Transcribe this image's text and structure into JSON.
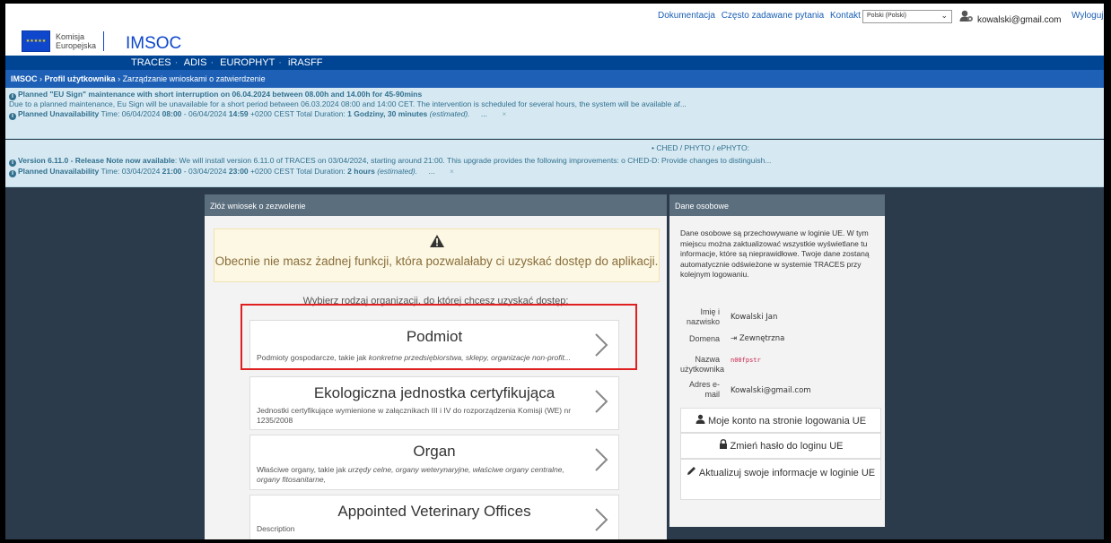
{
  "header": {
    "logo_line1": "Komisja",
    "logo_line2": "Europejska",
    "app_name": "IMSOC",
    "links": [
      "Dokumentacja",
      "Często zadawane pytania",
      "Kontakt"
    ],
    "language": "Polski (Polski)",
    "user_email": "kowalski@gmail.com",
    "logout": "Wyloguj"
  },
  "nav": {
    "items": [
      "TRACES",
      "ADIS",
      "EUROPHYT",
      "iRASFF"
    ]
  },
  "breadcrumb": {
    "root": "IMSOC",
    "profile": "Profil użytkownika",
    "current": "Zarządzanie wnioskami o zatwierdzenie"
  },
  "alerts": {
    "a1_title": "Planned \"EU Sign\" maintenance with short interruption on 06.04.2024 between 08.00h and 14.00h for 45-90mins",
    "a1_body": "Due to a planned maintenance, Eu Sign will be unavailable for a short period between 06.03.2024 08:00 and 14:00 CET. The intervention is scheduled for several hours, the system will be available af...",
    "a1_unavail_label": "Planned Unavailability",
    "a1_time_prefix": "Time: 06/04/2024",
    "a1_time_start": "08:00",
    "a1_time_mid": "- 06/04/2024",
    "a1_time_end": "14:59",
    "a1_tz": "+0200 CEST Total Duration:",
    "a1_duration": "1 Godziny, 30 minutes",
    "a1_estimated": "(estimated).",
    "a2_top": "• CHED / PHYTO / ePHYTO:",
    "a2_title": "Version 6.11.0 - Release Note now available",
    "a2_body": ": We will install version 6.11.0 of TRACES on 03/04/2024, starting around 21:00. This upgrade provides the following improvements:    o CHED-D: Provide changes to distinguish...",
    "a2_unavail_label": "Planned Unavailability",
    "a2_time_prefix": "Time: 03/04/2024",
    "a2_time_start": "21:00",
    "a2_time_mid": "- 03/04/2024",
    "a2_time_end": "23:00",
    "a2_tz": "+0200 CEST Total Duration:",
    "a2_duration": "2 hours",
    "a2_estimated": "(estimated).",
    "ellipsis": "...",
    "close": "×"
  },
  "left_panel": {
    "title": "Złóż wniosek o zezwolenie",
    "warning": "Obecnie nie masz żadnej funkcji, która pozwalałaby ci uzyskać dostęp do aplikacji.",
    "choose": "Wybierz rodzaj organizacji, do której chcesz uzyskać dostęp:",
    "cards": [
      {
        "title": "Podmiot",
        "desc_plain": "Podmioty gospodarcze, takie jak ",
        "desc_italic": "konkretne przedsiębiorstwa, sklepy, organizacje non-profit..."
      },
      {
        "title": "Ekologiczna jednostka certyfikująca",
        "desc_plain": "Jednostki certyfikujące wymienione w załącznikach III i IV do rozporządzenia Komisji (WE) nr 1235/2008",
        "desc_italic": ""
      },
      {
        "title": "Organ",
        "desc_plain": "Właściwe organy, takie jak ",
        "desc_italic": "urzędy celne, organy weterynaryjne, właściwe organy centralne, organy fitosanitarne,"
      },
      {
        "title": "Appointed Veterinary Offices",
        "desc_plain": "Description",
        "desc_italic": ""
      }
    ]
  },
  "right_panel": {
    "title": "Dane osobowe",
    "intro": "Dane osobowe są przechowywane w loginie UE. W tym miejscu można zaktualizować wszystkie wyświetlane tu informacje, które są nieprawidłowe. Twoje dane zostaną automatycznie odświeżone w systemie TRACES przy kolejnym logowaniu.",
    "name_label": "Imię i nazwisko",
    "name_value": "Kowalski Jan",
    "domain_label": "Domena",
    "domain_value": "Zewnętrzna",
    "username_label": "Nazwa użytkownika",
    "username_value": "n00fpstr",
    "email_label": "Adres e-mail",
    "email_value": "Kowalski@gmail.com",
    "btn_account": "Moje konto na stronie logowania UE",
    "btn_password": "Zmień hasło do loginu UE",
    "btn_update": "Aktualizuj swoje informacje w loginie UE"
  },
  "colors": {
    "nav": "#004494",
    "breadcrumb": "#1d60b6",
    "alert_bg": "#d6e9f2",
    "highlight": "#e02020",
    "page_bg": "#2b3b4b"
  }
}
